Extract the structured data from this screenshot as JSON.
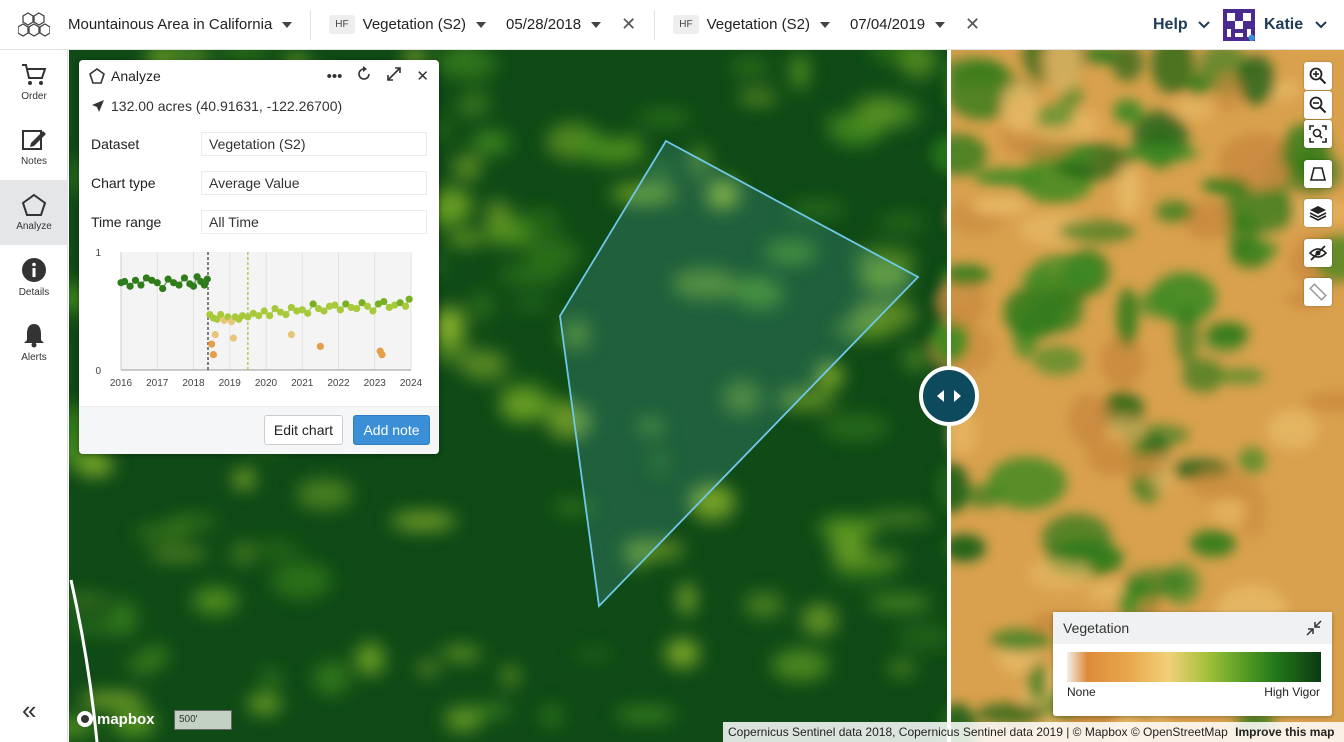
{
  "header": {
    "location_label": "Mountainous Area in California",
    "left_layer": {
      "badge": "HF",
      "dataset": "Vegetation (S2)",
      "date": "05/28/2018"
    },
    "right_layer": {
      "badge": "HF",
      "dataset": "Vegetation (S2)",
      "date": "07/04/2019"
    },
    "help_label": "Help",
    "user_name": "Katie"
  },
  "sidebar": {
    "items": [
      {
        "label": "Order",
        "icon": "cart-icon"
      },
      {
        "label": "Notes",
        "icon": "edit-icon"
      },
      {
        "label": "Analyze",
        "icon": "pentagon-icon",
        "active": true
      },
      {
        "label": "Details",
        "icon": "info-icon"
      },
      {
        "label": "Alerts",
        "icon": "bell-icon"
      }
    ],
    "collapse_label": "«"
  },
  "analyze": {
    "title": "Analyze",
    "area_text": "132.00 acres (40.91631, -122.26700)",
    "fields": [
      {
        "label": "Dataset",
        "value": "Vegetation (S2)"
      },
      {
        "label": "Chart type",
        "value": "Average Value"
      },
      {
        "label": "Time range",
        "value": "All Time"
      }
    ],
    "edit_label": "Edit chart",
    "add_note_label": "Add note"
  },
  "chart_data": {
    "type": "scatter",
    "title": "",
    "xlabel": "",
    "ylabel": "",
    "ylim": [
      0,
      1
    ],
    "y_ticks": [
      "0",
      "1"
    ],
    "x_ticks": [
      "2016",
      "2017",
      "2018",
      "2019",
      "2020",
      "2021",
      "2022",
      "2023",
      "2024"
    ],
    "markers": [
      {
        "x": 2018.4,
        "style": "dashed",
        "color": "#333333"
      },
      {
        "x": 2019.5,
        "style": "dashed",
        "color": "#9bc03c"
      }
    ],
    "series": [
      {
        "x": [
          2016.0,
          2016.1,
          2016.25,
          2016.4,
          2016.55,
          2016.7,
          2016.85,
          2017.0,
          2017.15,
          2017.3,
          2017.45,
          2017.6,
          2017.75,
          2017.9,
          2018.0,
          2018.1,
          2018.2,
          2018.3,
          2018.38
        ],
        "y": [
          0.74,
          0.75,
          0.71,
          0.76,
          0.72,
          0.78,
          0.76,
          0.74,
          0.69,
          0.77,
          0.74,
          0.72,
          0.78,
          0.73,
          0.71,
          0.79,
          0.75,
          0.72,
          0.77
        ]
      },
      {
        "x": [
          2018.45,
          2018.55,
          2018.65,
          2018.75,
          2018.85,
          2018.95,
          2019.05,
          2019.15,
          2019.25,
          2019.35,
          2019.5,
          2019.65,
          2019.8,
          2019.95,
          2020.1,
          2020.25,
          2020.4,
          2020.55,
          2020.7,
          2020.85,
          2021.0,
          2021.15,
          2021.3,
          2021.45,
          2021.6,
          2021.75,
          2021.9,
          2022.05,
          2022.2,
          2022.35,
          2022.5,
          2022.65,
          2022.8,
          2022.95,
          2023.1,
          2023.25,
          2023.4,
          2023.55,
          2023.7,
          2023.85,
          2023.95
        ],
        "y": [
          0.47,
          0.44,
          0.43,
          0.47,
          0.42,
          0.45,
          0.41,
          0.45,
          0.43,
          0.46,
          0.45,
          0.48,
          0.46,
          0.5,
          0.46,
          0.52,
          0.49,
          0.47,
          0.53,
          0.5,
          0.51,
          0.48,
          0.56,
          0.52,
          0.5,
          0.54,
          0.55,
          0.51,
          0.56,
          0.53,
          0.52,
          0.57,
          0.54,
          0.5,
          0.56,
          0.58,
          0.53,
          0.55,
          0.57,
          0.54,
          0.6
        ]
      },
      {
        "x": [
          2018.5,
          2018.55,
          2018.6,
          2019.1,
          2020.7,
          2021.5,
          2023.15,
          2023.2
        ],
        "y": [
          0.22,
          0.13,
          0.3,
          0.27,
          0.3,
          0.2,
          0.16,
          0.13
        ]
      }
    ]
  },
  "legend": {
    "title": "Vegetation",
    "low_label": "None",
    "high_label": "High Vigor"
  },
  "map": {
    "attribution": "Copernicus Sentinel data 2018, Copernicus Sentinel data 2019 | © Mapbox © OpenStreetMap",
    "improve_label": "Improve this map",
    "scale_label": "500'",
    "mapbox_label": "mapbox"
  },
  "colors": {
    "accent": "#3b8fd6",
    "polygon": "#6fc8e8",
    "swipe_handle": "#0d4a5e"
  }
}
